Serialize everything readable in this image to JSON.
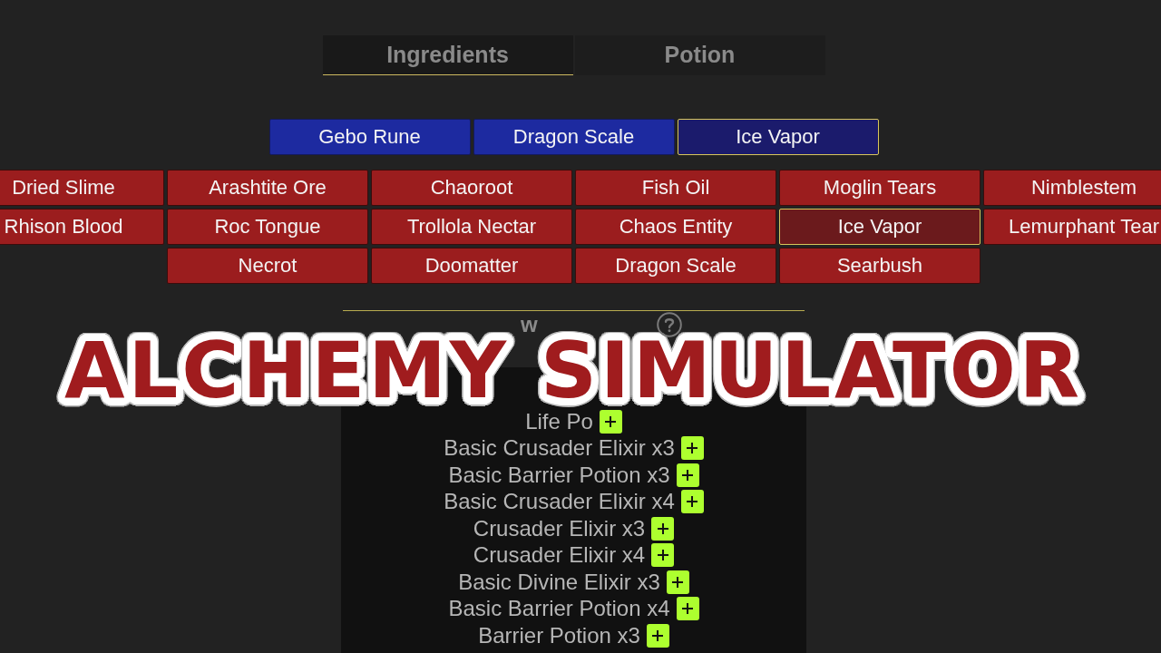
{
  "tabs": [
    {
      "label": "Ingredients",
      "selected": true
    },
    {
      "label": "Potion",
      "selected": false
    }
  ],
  "chosen_ingredients": [
    {
      "name": "Gebo Rune",
      "selected": false
    },
    {
      "name": "Dragon Scale",
      "selected": false
    },
    {
      "name": "Ice Vapor",
      "selected": true
    }
  ],
  "ingredients": [
    {
      "name": "Dried Slime",
      "selected": false
    },
    {
      "name": "Arashtite Ore",
      "selected": false
    },
    {
      "name": "Chaoroot",
      "selected": false
    },
    {
      "name": "Fish Oil",
      "selected": false
    },
    {
      "name": "Moglin Tears",
      "selected": false
    },
    {
      "name": "Nimblestem",
      "selected": false
    },
    {
      "name": "Rhison Blood",
      "selected": false
    },
    {
      "name": "Roc Tongue",
      "selected": false
    },
    {
      "name": "Trollola Nectar",
      "selected": false
    },
    {
      "name": "Chaos Entity",
      "selected": false
    },
    {
      "name": "Ice Vapor",
      "selected": true
    },
    {
      "name": "Lemurphant Tear",
      "selected": false
    },
    {
      "name": "Necrot",
      "selected": false
    },
    {
      "name": "Doomatter",
      "selected": false
    },
    {
      "name": "Dragon Scale",
      "selected": false
    },
    {
      "name": "Searbush",
      "selected": false
    }
  ],
  "recipes": {
    "heading": "w",
    "items": [
      "Life Po",
      "Basic Crusader Elixir x3",
      "Basic Barrier Potion x3",
      "Basic Crusader Elixir x4",
      "Crusader Elixir x3",
      "Crusader Elixir x4",
      "Basic Divine Elixir x3",
      "Basic Barrier Potion x4",
      "Barrier Potion x3"
    ]
  },
  "overlay_title": "ALCHEMY SIMULATOR"
}
